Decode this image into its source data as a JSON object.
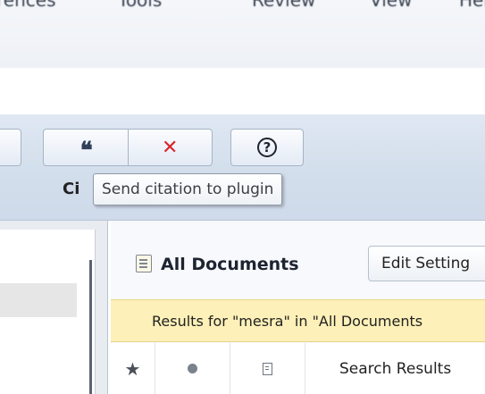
{
  "menubar": {
    "items": [
      "rences",
      "Tools",
      "Review",
      "View",
      "Help"
    ]
  },
  "toolbar": {
    "cite_label_partial": "Ci",
    "tooltip": "Send citation to plugin",
    "icons": [
      "quote-icon",
      "remove-icon",
      "help-icon"
    ]
  },
  "main": {
    "title": "All Documents",
    "edit_settings": "Edit Setting",
    "results_text": "Results for \"mesra\" in \"All Documents",
    "row": {
      "title": "Search Results"
    }
  },
  "colors": {
    "toolbar_bg": "#d3deec",
    "results_bg": "#fdf0b8",
    "remove_red": "#d8252c"
  }
}
